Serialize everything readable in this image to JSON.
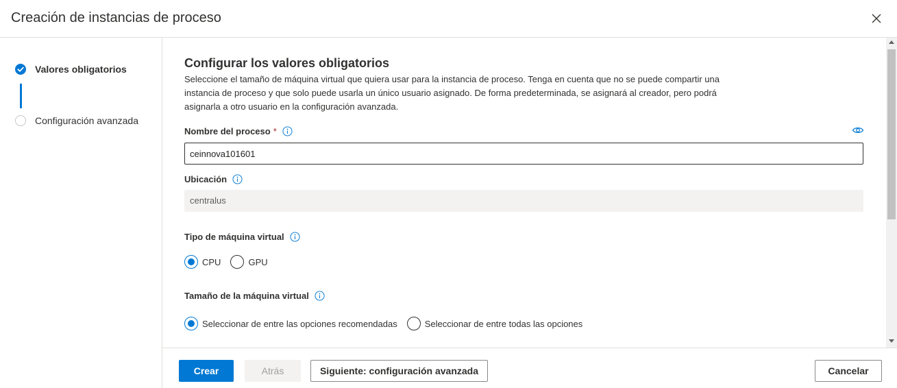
{
  "dialog": {
    "title": "Creación de instancias de proceso",
    "close_icon": "close-icon"
  },
  "steps": [
    {
      "label": "Valores obligatorios",
      "state": "completed",
      "icon": "checkmark-circle-icon"
    },
    {
      "label": "Configuración avanzada",
      "state": "pending",
      "icon": "empty-circle-icon"
    }
  ],
  "main": {
    "heading": "Configurar los valores obligatorios",
    "description": "Seleccione el tamaño de máquina virtual que quiera usar para la instancia de proceso. Tenga en cuenta que no se puede compartir una instancia de proceso y que solo puede usarla un único usuario asignado. De forma predeterminada, se asignará al creador, pero podrá asignarla a otro usuario en la configuración avanzada.",
    "compute_name": {
      "label": "Nombre del proceso",
      "required_mark": "*",
      "value": "ceinnova101601"
    },
    "location": {
      "label": "Ubicación",
      "value": "centralus"
    },
    "vm_type": {
      "label": "Tipo de máquina virtual",
      "options": [
        {
          "label": "CPU",
          "selected": true
        },
        {
          "label": "GPU",
          "selected": false
        }
      ]
    },
    "vm_size": {
      "label": "Tamaño de la máquina virtual",
      "options": [
        {
          "label": "Seleccionar de entre las opciones recomendadas",
          "selected": true
        },
        {
          "label": "Seleccionar de entre todas las opciones",
          "selected": false
        }
      ]
    }
  },
  "footer": {
    "create_label": "Crear",
    "back_label": "Atrás",
    "next_label": "Siguiente: configuración avanzada",
    "cancel_label": "Cancelar"
  },
  "colors": {
    "accent": "#0078d4",
    "required": "#a4262c",
    "disabled_bg": "#f3f2f1"
  }
}
